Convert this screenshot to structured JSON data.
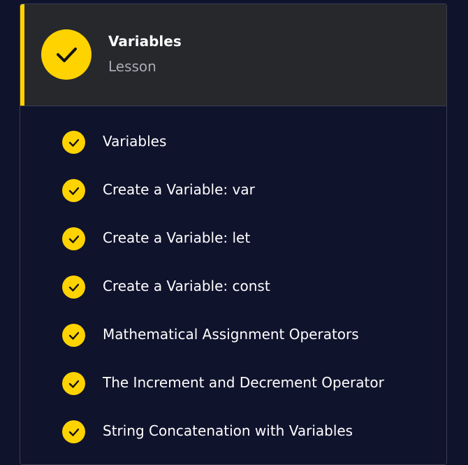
{
  "lesson": {
    "title": "Variables",
    "subtitle": "Lesson",
    "status_icon": "check-icon",
    "accent_color": "#ffd300"
  },
  "items": [
    {
      "label": "Variables",
      "completed": true
    },
    {
      "label": "Create a Variable: var",
      "completed": true
    },
    {
      "label": "Create a Variable: let",
      "completed": true
    },
    {
      "label": "Create a Variable: const",
      "completed": true
    },
    {
      "label": "Mathematical Assignment Operators",
      "completed": true
    },
    {
      "label": "The Increment and Decrement Operator",
      "completed": true
    },
    {
      "label": "String Concatenation with Variables",
      "completed": true
    }
  ]
}
